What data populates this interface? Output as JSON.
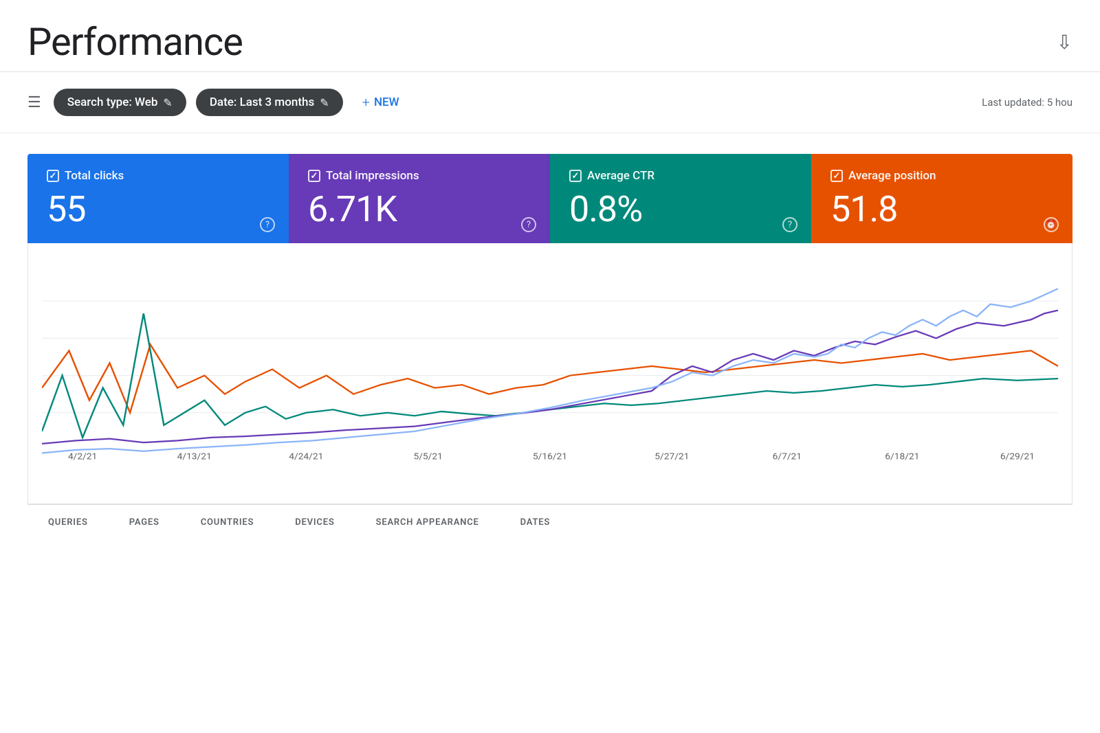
{
  "header": {
    "title": "Performance",
    "download_tooltip": "Download"
  },
  "toolbar": {
    "search_type_label": "Search type: Web",
    "date_label": "Date: Last 3 months",
    "new_button_label": "NEW",
    "last_updated": "Last updated: 5 hou"
  },
  "metric_cards": [
    {
      "id": "total-clicks",
      "label": "Total clicks",
      "value": "55",
      "color": "blue",
      "help_type": "question"
    },
    {
      "id": "total-impressions",
      "label": "Total impressions",
      "value": "6.71K",
      "color": "purple",
      "help_type": "question"
    },
    {
      "id": "average-ctr",
      "label": "Average CTR",
      "value": "0.8%",
      "color": "teal",
      "help_type": "question"
    },
    {
      "id": "average-position",
      "label": "Average position",
      "value": "51.8",
      "color": "orange",
      "help_type": "clock"
    }
  ],
  "chart": {
    "x_labels": [
      "4/2/21",
      "4/13/21",
      "4/24/21",
      "5/5/21",
      "5/16/21",
      "5/27/21",
      "6/7/21",
      "6/18/21",
      "6/29/21"
    ],
    "lines": [
      {
        "id": "clicks",
        "color": "#1a73e8",
        "label": "Total clicks"
      },
      {
        "id": "impressions",
        "color": "#8ab4f8",
        "label": "Total impressions"
      },
      {
        "id": "ctr",
        "color": "#e65100",
        "label": "Average CTR"
      },
      {
        "id": "position",
        "color": "#00897b",
        "label": "Average position"
      }
    ]
  },
  "bottom_tabs": [
    {
      "id": "queries",
      "label": "QUERIES"
    },
    {
      "id": "pages",
      "label": "PAGES"
    },
    {
      "id": "countries",
      "label": "COUNTRIES"
    },
    {
      "id": "devices",
      "label": "DEVICES"
    },
    {
      "id": "search-appearance",
      "label": "SEARCH APPEARANCE"
    },
    {
      "id": "dates",
      "label": "DATES"
    }
  ]
}
